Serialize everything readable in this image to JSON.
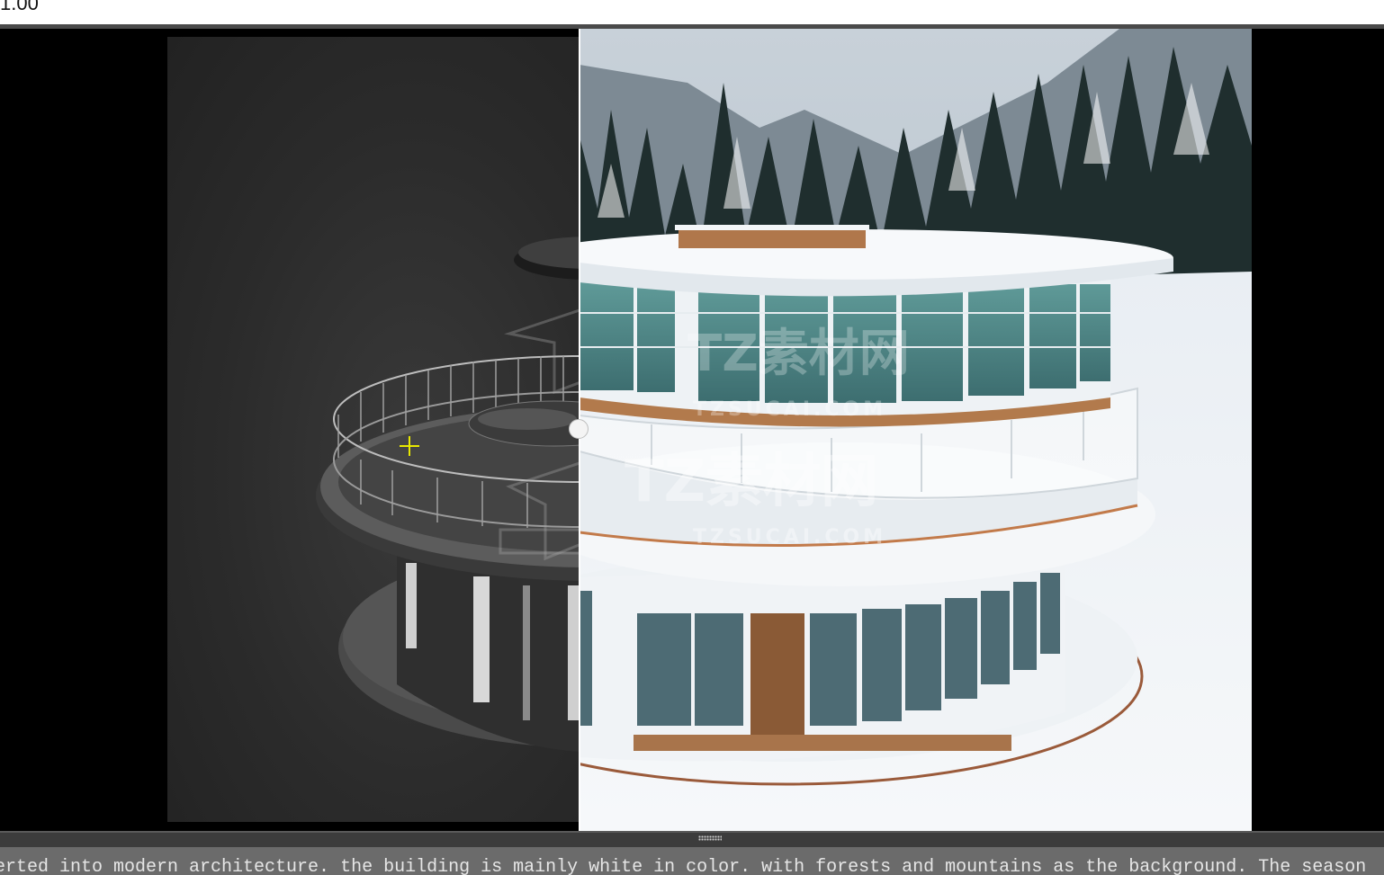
{
  "toolbar": {
    "zoom_value": "1.00"
  },
  "viewer": {
    "mode": "before-after comparison",
    "left_panel": "3D model render (grey)",
    "right_panel": "rendered photo"
  },
  "watermarks": {
    "main": "TZ素材网",
    "sub": "TZSUCAI.COM"
  },
  "prompt": {
    "text": "erted into modern architecture. the building is mainly white in color. with forests and mountains as the background. The season"
  },
  "colors": {
    "cursor": "#e8e800",
    "divider": "#ffffff",
    "prompt_bg": "#6b6b6b"
  }
}
